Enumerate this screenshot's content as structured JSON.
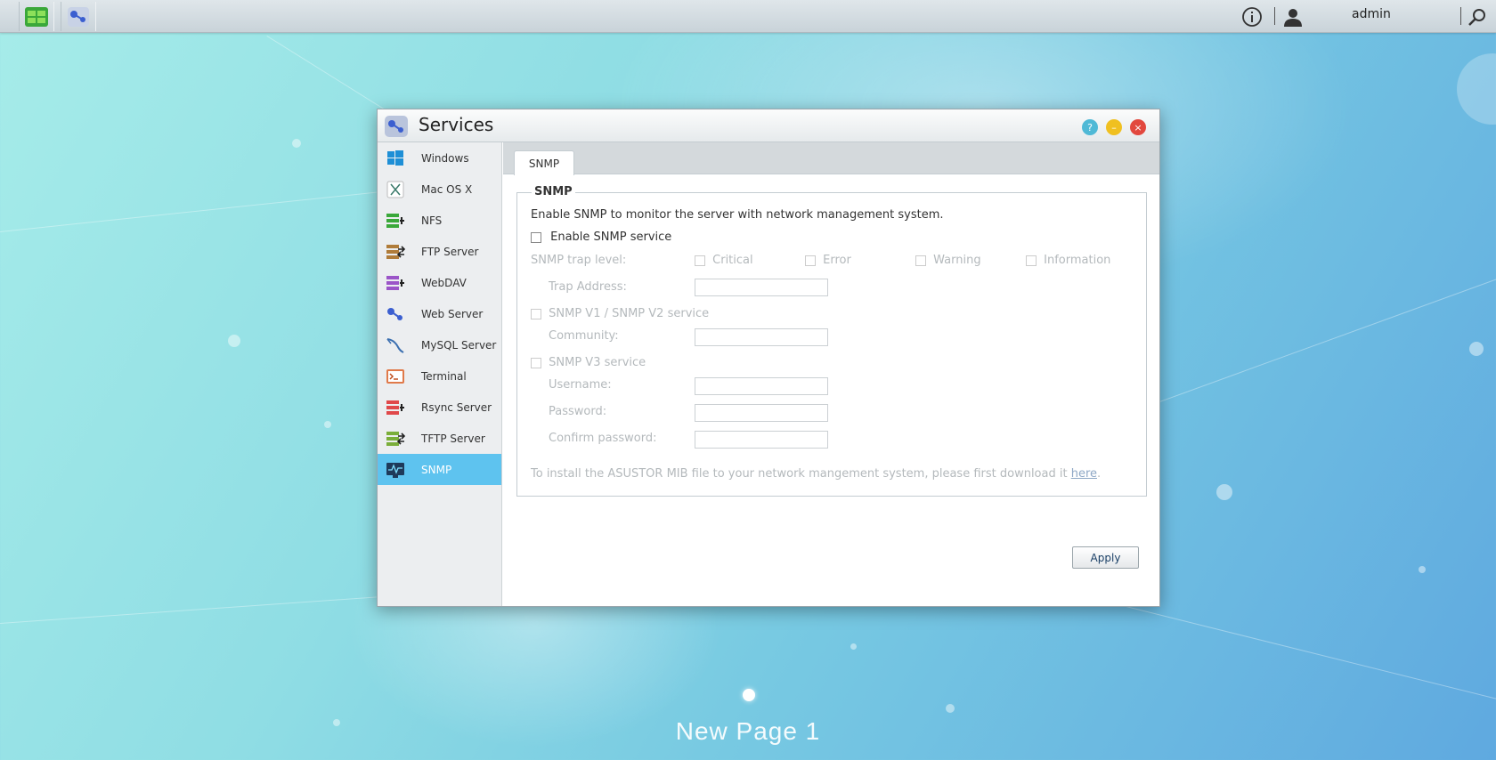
{
  "topbar": {
    "apps": [
      {
        "name": "app-manager",
        "icon": "app-grid-icon"
      },
      {
        "name": "services-app",
        "icon": "services-icon"
      }
    ],
    "user": "admin",
    "icons": [
      "info-icon",
      "user-icon",
      "search-icon"
    ]
  },
  "window": {
    "title": "Services",
    "controls": [
      "help-icon",
      "minimize-icon",
      "close-icon"
    ],
    "sidebar": {
      "items": [
        {
          "label": "Windows",
          "icon": "windows-icon"
        },
        {
          "label": "Mac OS X",
          "icon": "mac-icon"
        },
        {
          "label": "NFS",
          "icon": "nfs-icon"
        },
        {
          "label": "FTP Server",
          "icon": "ftp-icon"
        },
        {
          "label": "WebDAV",
          "icon": "webdav-icon"
        },
        {
          "label": "Web Server",
          "icon": "web-server-icon"
        },
        {
          "label": "MySQL Server",
          "icon": "mysql-icon"
        },
        {
          "label": "Terminal",
          "icon": "terminal-icon"
        },
        {
          "label": "Rsync Server",
          "icon": "rsync-icon"
        },
        {
          "label": "TFTP Server",
          "icon": "tftp-icon"
        },
        {
          "label": "SNMP",
          "icon": "snmp-icon",
          "active": true
        }
      ]
    },
    "tabs": [
      {
        "label": "SNMP"
      }
    ],
    "snmp": {
      "legend": "SNMP",
      "description": "Enable SNMP to monitor the server with network management system.",
      "enable_label": "Enable SNMP service",
      "trap_level_label": "SNMP trap level:",
      "trap_levels": [
        "Critical",
        "Error",
        "Warning",
        "Information"
      ],
      "trap_address_label": "Trap Address:",
      "v1v2_label": "SNMP V1 / SNMP V2 service",
      "community_label": "Community:",
      "v3_label": "SNMP V3 service",
      "username_label": "Username:",
      "password_label": "Password:",
      "confirm_label": "Confirm password:",
      "mib_text": "To install the ASUSTOR MIB file to your network mangement system, please first download it ",
      "mib_link": "here",
      "mib_end": "."
    },
    "apply_label": "Apply"
  },
  "desktop": {
    "page_label": "New Page 1"
  }
}
